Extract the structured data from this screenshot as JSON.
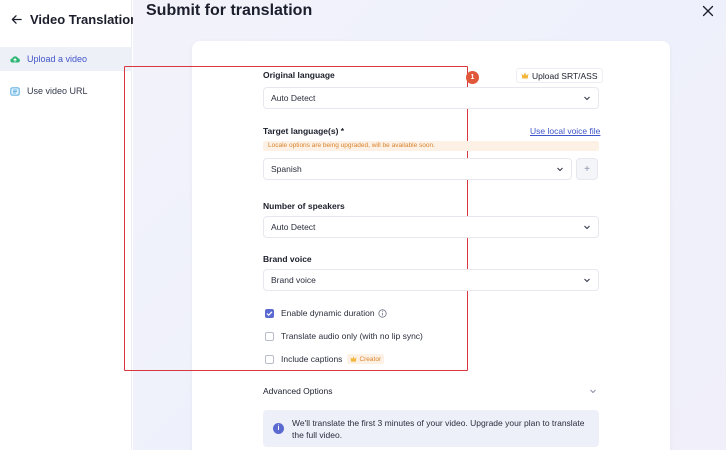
{
  "sidebar": {
    "title": "Video Translation",
    "items": [
      {
        "label": "Upload a video",
        "active": true,
        "icon": "cloud-upload-icon"
      },
      {
        "label": "Use video URL",
        "active": false,
        "icon": "link-box-icon"
      }
    ]
  },
  "main": {
    "title": "Submit for translation"
  },
  "form": {
    "annotation_number": "1",
    "original_language": {
      "label": "Original language",
      "value": "Auto Detect",
      "upload_label": "Upload SRT/ASS"
    },
    "target_language": {
      "label": "Target language(s) *",
      "link_label": "Use local voice file",
      "notice": "Locale options are being upgraded, will be available soon.",
      "value": "Spanish",
      "add_label": "+"
    },
    "speakers": {
      "label": "Number of speakers",
      "value": "Auto Detect"
    },
    "brand_voice": {
      "label": "Brand voice",
      "value": "Brand voice"
    },
    "checkboxes": [
      {
        "label": "Enable dynamic duration",
        "checked": true,
        "has_info": true
      },
      {
        "label": "Translate audio only (with no lip sync)",
        "checked": false
      },
      {
        "label": "Include captions",
        "checked": false,
        "tag": "Creator"
      }
    ],
    "advanced": {
      "label": "Advanced Options"
    },
    "info": {
      "icon_glyph": "i",
      "text": "We'll translate the first 3 minutes of your video. Upgrade your plan to translate the full video."
    }
  },
  "colors": {
    "accent": "#3f55c9",
    "highlight": "#d9363e",
    "warning": "#d9822b"
  }
}
